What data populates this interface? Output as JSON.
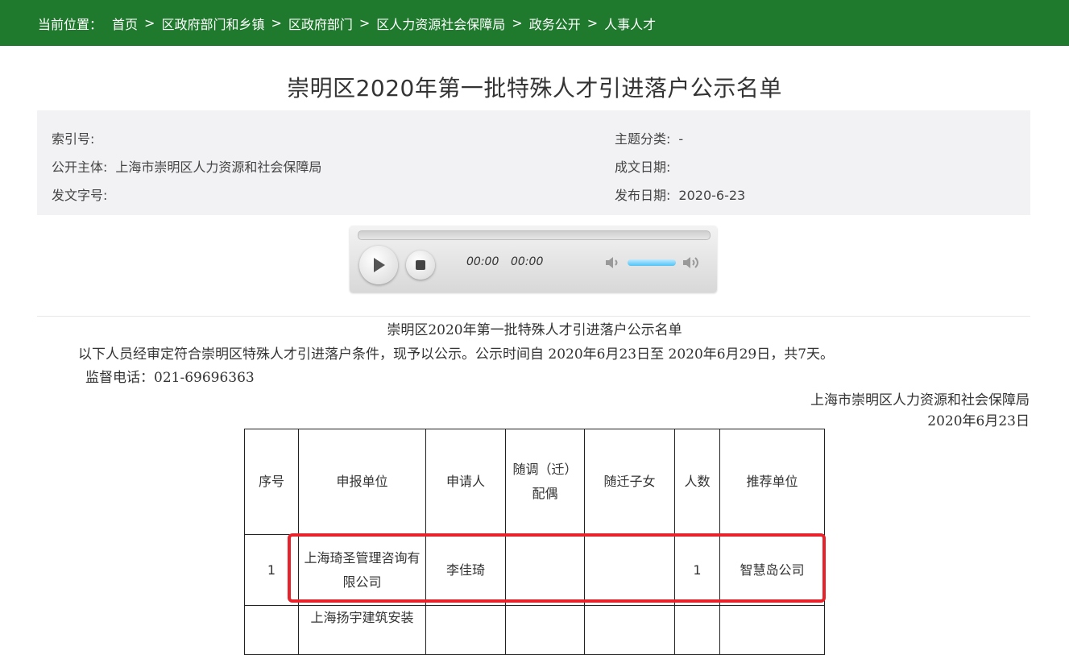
{
  "breadcrumb": {
    "lead": "当前位置：",
    "items": [
      "首页",
      "区政府部门和乡镇",
      "区政府部门",
      "区人力资源社会保障局",
      "政务公开",
      "人事人才"
    ],
    "separator": ">"
  },
  "page_title": "崇明区2020年第一批特殊人才引进落户公示名单",
  "meta": {
    "index_label": "索引号:",
    "index_value": "",
    "topic_label": "主题分类:",
    "topic_value": "-",
    "publisher_label": "公开主体:",
    "publisher_value": "上海市崇明区人力资源和社会保障局",
    "written_date_label": "成文日期:",
    "written_date_value": "",
    "doc_number_label": "发文字号:",
    "doc_number_value": "",
    "publish_date_label": "发布日期:",
    "publish_date_value": "2020-6-23"
  },
  "audio": {
    "current_time": "00:00",
    "duration": "00:00",
    "play_icon": "play-icon",
    "stop_icon": "stop-icon",
    "volume_level": 0.75
  },
  "document": {
    "title": "崇明区2020年第一批特殊人才引进落户公示名单",
    "intro": "以下人员经审定符合崇明区特殊人才引进落户条件，现予以公示。公示时间自 2020年6月23日至 2020年6月29日，共7天。",
    "phone": "监督电话：021-69696363",
    "org": "上海市崇明区人力资源和社会保障局",
    "date": "2020年6月23日"
  },
  "table": {
    "headers": [
      "序号",
      "申报单位",
      "申请人",
      "随调（迁）配偶",
      "随迁子女",
      "人数",
      "推荐单位"
    ],
    "rows": [
      [
        "1",
        "上海琦圣管理咨询有限公司",
        "李佳琦",
        "",
        "",
        "1",
        "智慧岛公司"
      ],
      [
        "",
        "上海扬宇建筑安装",
        "",
        "",
        "",
        "",
        ""
      ]
    ]
  },
  "highlight_color": "#e8222b",
  "brand_color": "#1f7a2e"
}
